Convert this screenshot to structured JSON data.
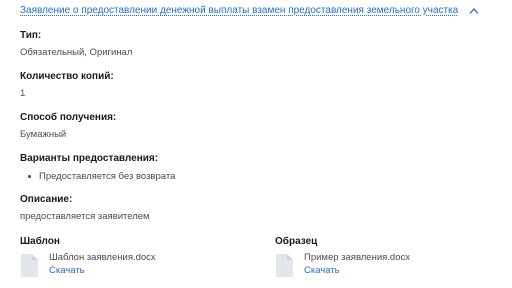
{
  "header": {
    "title": "Заявление о предоставлении денежной выплаты взамен предоставления земельного участка",
    "toggle_icon": "chevron-up-icon"
  },
  "fields": {
    "type": {
      "label": "Тип:",
      "value": "Обязательный, Оригинал"
    },
    "copies": {
      "label": "Количество копий:",
      "value": "1"
    },
    "method": {
      "label": "Способ получения:",
      "value": "Бумажный"
    },
    "variants": {
      "label": "Варианты предоставления:",
      "items": [
        "Предоставляется без возврата"
      ]
    },
    "description": {
      "label": "Описание:",
      "value": "предоставляется заявителем"
    }
  },
  "template": {
    "label": "Шаблон",
    "file_name": "Шаблон заявления.docx",
    "download": "Скачать",
    "icon": "document-icon"
  },
  "sample": {
    "label": "Образец",
    "file_name": "Пример заявления.docx",
    "download": "Скачать",
    "icon": "document-icon"
  },
  "colors": {
    "link": "#2a6ebb",
    "label": "#1a1a1a",
    "value": "#4d4d4d",
    "icon": "#e3e7ec"
  }
}
